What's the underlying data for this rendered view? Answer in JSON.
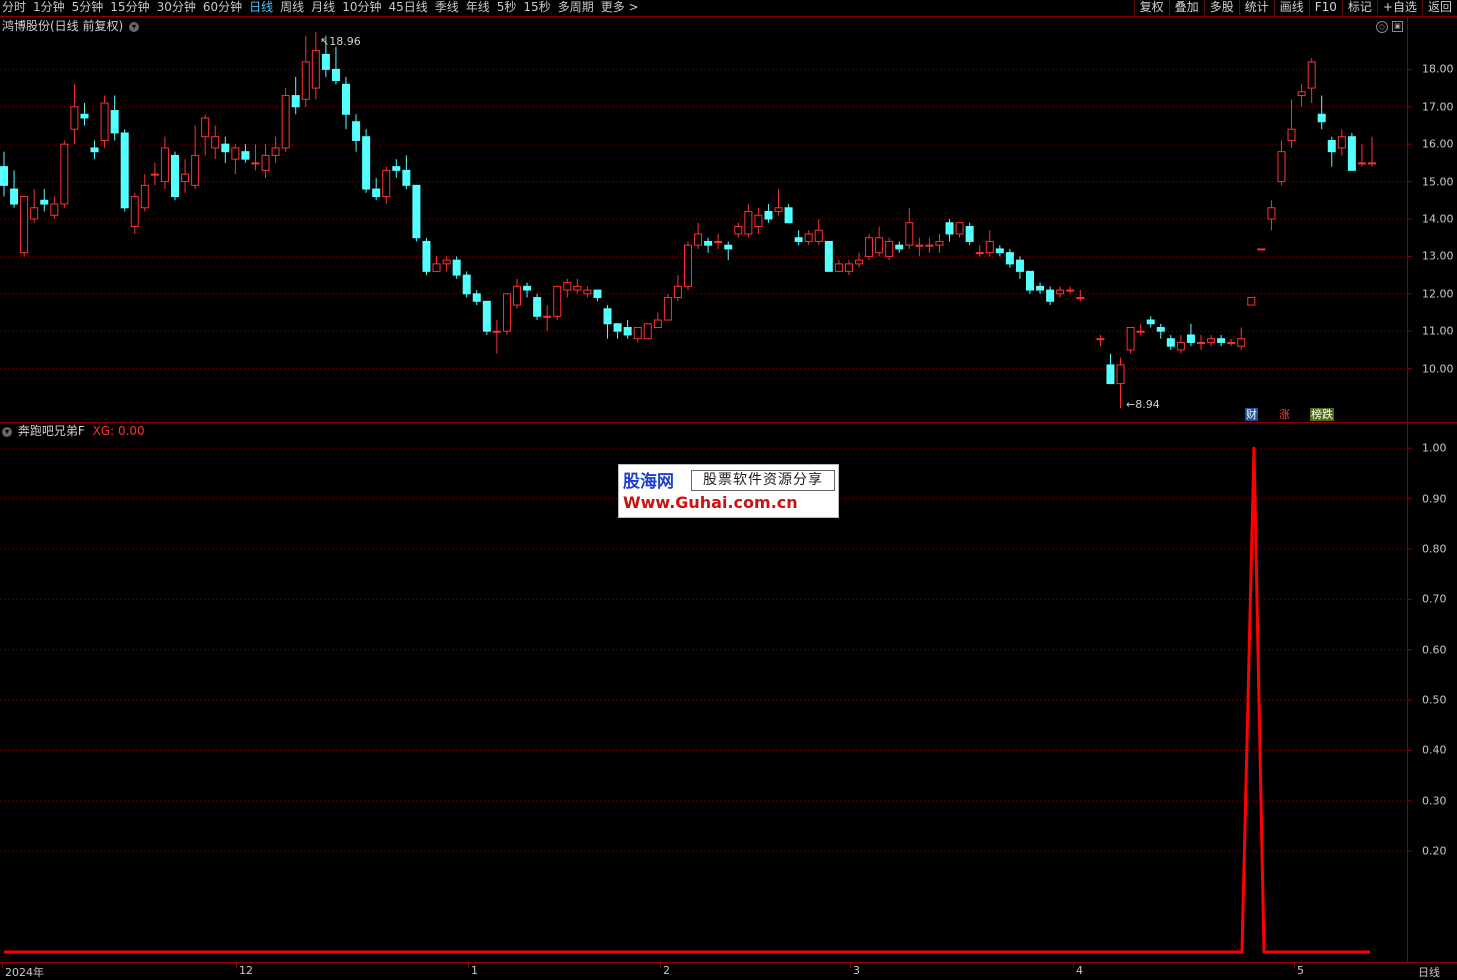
{
  "toolbar": {
    "periods": [
      "分时",
      "1分钟",
      "5分钟",
      "15分钟",
      "30分钟",
      "60分钟",
      "日线",
      "周线",
      "月线",
      "10分钟",
      "45日线",
      "季线",
      "年线",
      "5秒",
      "15秒",
      "多周期",
      "更多 >"
    ],
    "active_period": "日线",
    "right_buttons": [
      "复权",
      "叠加",
      "多股",
      "统计",
      "画线",
      "F10",
      "标记",
      "+自选",
      "返回"
    ]
  },
  "main_panel": {
    "title": "鸿博股份(日线 前复权)",
    "high_marker": "18.96",
    "low_marker": "8.94",
    "badges": [
      {
        "text": "财",
        "color": "#3a7bd5"
      },
      {
        "text": "涨",
        "color": "#e04040"
      },
      {
        "text": "榜跌",
        "color": "#d8c020"
      }
    ]
  },
  "indicator_panel": {
    "name": "奔跑吧兄弟F",
    "xg_label": "XG: 0.00"
  },
  "watermark": {
    "logo": "股海网",
    "slogan": "股票软件资源分享",
    "url": "Www.Guhai.com.cn"
  },
  "date_axis": {
    "labels": [
      "2024年",
      "12",
      "1",
      "2",
      "3",
      "4",
      "5"
    ],
    "period_label": "日线"
  },
  "colors": {
    "up": "#ff3232",
    "down": "#54ffff",
    "grid": "#8b0000",
    "indicator_line": "#ff0000"
  },
  "chart_data": [
    {
      "type": "candlestick",
      "title": "",
      "ylim": [
        8.6,
        19.4
      ],
      "y_ticks": [
        10.0,
        11.0,
        12.0,
        13.0,
        14.0,
        15.0,
        16.0,
        17.0,
        18.0
      ],
      "high": 18.96,
      "low": 8.94,
      "candles": [
        [
          15.4,
          14.9,
          15.8,
          14.6
        ],
        [
          14.8,
          14.4,
          15.3,
          14.3
        ],
        [
          13.1,
          14.6,
          14.6,
          13.0
        ],
        [
          14.0,
          14.3,
          14.8,
          13.9
        ],
        [
          14.5,
          14.4,
          14.8,
          14.2
        ],
        [
          14.1,
          14.4,
          14.6,
          14.0
        ],
        [
          14.4,
          16.0,
          16.1,
          14.3
        ],
        [
          16.4,
          17.0,
          17.6,
          16.0
        ],
        [
          16.8,
          16.7,
          17.1,
          16.5
        ],
        [
          15.9,
          15.8,
          16.1,
          15.6
        ],
        [
          16.1,
          17.1,
          17.3,
          15.9
        ],
        [
          16.9,
          16.3,
          17.3,
          16.1
        ],
        [
          16.3,
          14.3,
          16.4,
          14.2
        ],
        [
          13.8,
          14.6,
          14.7,
          13.6
        ],
        [
          14.3,
          14.9,
          15.2,
          14.2
        ],
        [
          15.2,
          15.2,
          15.5,
          14.9
        ],
        [
          15.0,
          15.9,
          16.2,
          14.8
        ],
        [
          15.7,
          14.6,
          15.8,
          14.5
        ],
        [
          15.0,
          15.2,
          15.6,
          14.7
        ],
        [
          14.9,
          15.7,
          16.5,
          14.8
        ],
        [
          16.2,
          16.7,
          16.8,
          15.7
        ],
        [
          15.9,
          16.2,
          16.5,
          15.6
        ],
        [
          16.0,
          15.8,
          16.2,
          15.5
        ],
        [
          15.6,
          15.9,
          16.0,
          15.2
        ],
        [
          15.8,
          15.6,
          16.0,
          15.5
        ],
        [
          15.5,
          15.5,
          16.0,
          15.3
        ],
        [
          15.3,
          15.7,
          16.0,
          15.1
        ],
        [
          15.7,
          15.9,
          16.2,
          15.5
        ],
        [
          15.9,
          17.3,
          17.5,
          15.8
        ],
        [
          17.3,
          17.0,
          17.8,
          16.8
        ],
        [
          17.2,
          18.2,
          18.9,
          17.0
        ],
        [
          17.5,
          18.5,
          19.0,
          17.2
        ],
        [
          18.4,
          18.0,
          18.9,
          17.8
        ],
        [
          18.0,
          17.7,
          18.6,
          17.6
        ],
        [
          17.6,
          16.8,
          17.8,
          16.4
        ],
        [
          16.6,
          16.1,
          16.8,
          15.8
        ],
        [
          16.2,
          14.8,
          16.4,
          14.7
        ],
        [
          14.8,
          14.6,
          15.1,
          14.5
        ],
        [
          14.6,
          15.3,
          15.4,
          14.4
        ],
        [
          15.4,
          15.3,
          15.6,
          15.1
        ],
        [
          15.3,
          14.9,
          15.7,
          14.8
        ],
        [
          14.9,
          13.5,
          14.9,
          13.4
        ],
        [
          13.4,
          12.6,
          13.5,
          12.5
        ],
        [
          12.6,
          12.8,
          13.0,
          12.6
        ],
        [
          12.8,
          12.9,
          13.0,
          12.6
        ],
        [
          12.9,
          12.5,
          13.0,
          12.4
        ],
        [
          12.5,
          12.0,
          12.6,
          11.9
        ],
        [
          12.0,
          11.8,
          12.1,
          11.7
        ],
        [
          11.8,
          11.0,
          11.8,
          10.9
        ],
        [
          11.0,
          11.0,
          11.3,
          10.4
        ],
        [
          11.0,
          12.0,
          12.0,
          10.9
        ],
        [
          11.7,
          12.2,
          12.4,
          11.6
        ],
        [
          12.2,
          12.1,
          12.3,
          11.9
        ],
        [
          11.9,
          11.4,
          12.0,
          11.3
        ],
        [
          11.4,
          11.4,
          11.7,
          11.0
        ],
        [
          11.4,
          12.2,
          12.2,
          11.3
        ],
        [
          12.1,
          12.3,
          12.4,
          11.9
        ],
        [
          12.1,
          12.2,
          12.4,
          12.0
        ],
        [
          12.0,
          12.1,
          12.2,
          11.9
        ],
        [
          12.1,
          11.9,
          12.1,
          11.8
        ],
        [
          11.6,
          11.2,
          11.7,
          10.8
        ],
        [
          11.2,
          11.0,
          11.2,
          10.8
        ],
        [
          11.1,
          10.9,
          11.3,
          10.8
        ],
        [
          10.8,
          11.1,
          11.1,
          10.7
        ],
        [
          10.8,
          11.2,
          11.2,
          10.8
        ],
        [
          11.1,
          11.3,
          11.5,
          11.1
        ],
        [
          11.3,
          11.9,
          12.0,
          11.3
        ],
        [
          11.9,
          12.2,
          12.5,
          11.8
        ],
        [
          12.2,
          13.3,
          13.4,
          12.1
        ],
        [
          13.3,
          13.6,
          13.9,
          13.2
        ],
        [
          13.4,
          13.3,
          13.5,
          13.1
        ],
        [
          13.4,
          13.4,
          13.6,
          13.2
        ],
        [
          13.3,
          13.2,
          13.4,
          12.9
        ],
        [
          13.6,
          13.8,
          13.9,
          13.5
        ],
        [
          13.6,
          14.2,
          14.4,
          13.5
        ],
        [
          13.8,
          14.1,
          14.3,
          13.6
        ],
        [
          14.2,
          14.0,
          14.4,
          13.9
        ],
        [
          14.2,
          14.3,
          14.8,
          14.1
        ],
        [
          14.3,
          13.9,
          14.4,
          13.9
        ],
        [
          13.5,
          13.4,
          13.7,
          13.3
        ],
        [
          13.4,
          13.6,
          13.7,
          13.3
        ],
        [
          13.4,
          13.7,
          14.0,
          13.3
        ],
        [
          13.4,
          12.6,
          13.4,
          12.6
        ],
        [
          12.6,
          12.8,
          12.9,
          12.6
        ],
        [
          12.6,
          12.8,
          12.9,
          12.5
        ],
        [
          12.8,
          12.9,
          13.1,
          12.7
        ],
        [
          13.0,
          13.5,
          13.6,
          12.9
        ],
        [
          13.1,
          13.5,
          13.8,
          13.0
        ],
        [
          13.0,
          13.4,
          13.5,
          12.9
        ],
        [
          13.3,
          13.2,
          13.4,
          13.1
        ],
        [
          13.3,
          13.9,
          14.3,
          13.2
        ],
        [
          13.3,
          13.3,
          13.5,
          13.0
        ],
        [
          13.3,
          13.3,
          13.5,
          13.1
        ],
        [
          13.3,
          13.4,
          13.6,
          13.1
        ],
        [
          13.9,
          13.6,
          14.0,
          13.4
        ],
        [
          13.6,
          13.9,
          13.9,
          13.5
        ],
        [
          13.8,
          13.4,
          13.9,
          13.3
        ],
        [
          13.1,
          13.1,
          13.3,
          13.0
        ],
        [
          13.1,
          13.4,
          13.7,
          13.0
        ],
        [
          13.2,
          13.1,
          13.3,
          13.0
        ],
        [
          13.1,
          12.8,
          13.2,
          12.7
        ],
        [
          12.9,
          12.6,
          13.0,
          12.4
        ],
        [
          12.6,
          12.1,
          12.6,
          12.0
        ],
        [
          12.2,
          12.1,
          12.3,
          12.0
        ],
        [
          12.1,
          11.8,
          12.2,
          11.7
        ],
        [
          12.0,
          12.1,
          12.2,
          11.9
        ],
        [
          12.1,
          12.1,
          12.2,
          12.0
        ],
        [
          11.9,
          11.9,
          12.1,
          11.8
        ],
        null,
        [
          10.8,
          10.8,
          10.9,
          10.6
        ],
        [
          10.1,
          9.6,
          10.4,
          9.6
        ],
        [
          9.6,
          10.1,
          10.3,
          8.94
        ],
        [
          10.5,
          11.1,
          11.1,
          10.4
        ],
        [
          11.0,
          11.0,
          11.2,
          10.9
        ],
        [
          11.3,
          11.2,
          11.4,
          11.1
        ],
        [
          11.1,
          11.0,
          11.2,
          10.8
        ],
        [
          10.8,
          10.6,
          10.9,
          10.5
        ],
        [
          10.5,
          10.7,
          10.9,
          10.4
        ],
        [
          10.9,
          10.7,
          11.2,
          10.6
        ],
        [
          10.7,
          10.7,
          10.9,
          10.5
        ],
        [
          10.7,
          10.8,
          10.9,
          10.6
        ],
        [
          10.8,
          10.7,
          10.9,
          10.6
        ],
        [
          10.7,
          10.7,
          10.8,
          10.6
        ],
        [
          10.6,
          10.8,
          11.1,
          10.5
        ],
        [
          11.7,
          11.9,
          11.9,
          11.7
        ],
        [
          13.2,
          13.2,
          13.2,
          13.2
        ],
        [
          14.0,
          14.3,
          14.5,
          13.7
        ],
        [
          15.0,
          15.8,
          16.1,
          14.9
        ],
        [
          16.1,
          16.4,
          17.2,
          15.9
        ],
        [
          17.3,
          17.4,
          17.6,
          17.0
        ],
        [
          17.5,
          18.2,
          18.3,
          17.1
        ],
        [
          16.8,
          16.6,
          17.3,
          16.4
        ],
        [
          16.1,
          15.8,
          16.2,
          15.4
        ],
        [
          15.9,
          16.2,
          16.4,
          15.7
        ],
        [
          16.2,
          15.3,
          16.3,
          15.3
        ],
        [
          15.5,
          15.5,
          16.0,
          15.4
        ],
        [
          15.5,
          15.5,
          16.2,
          15.4
        ]
      ]
    },
    {
      "type": "line",
      "title": "",
      "series": [
        {
          "name": "XG",
          "values": [
            0,
            0,
            0,
            0,
            0,
            0,
            0,
            0,
            0,
            0,
            1,
            0,
            0,
            0,
            0,
            0,
            0
          ]
        }
      ],
      "ylim": [
        0,
        1.05
      ],
      "y_ticks": [
        0.2,
        0.3,
        0.4,
        0.5,
        0.6,
        0.7,
        0.8,
        0.9,
        1.0
      ]
    }
  ]
}
